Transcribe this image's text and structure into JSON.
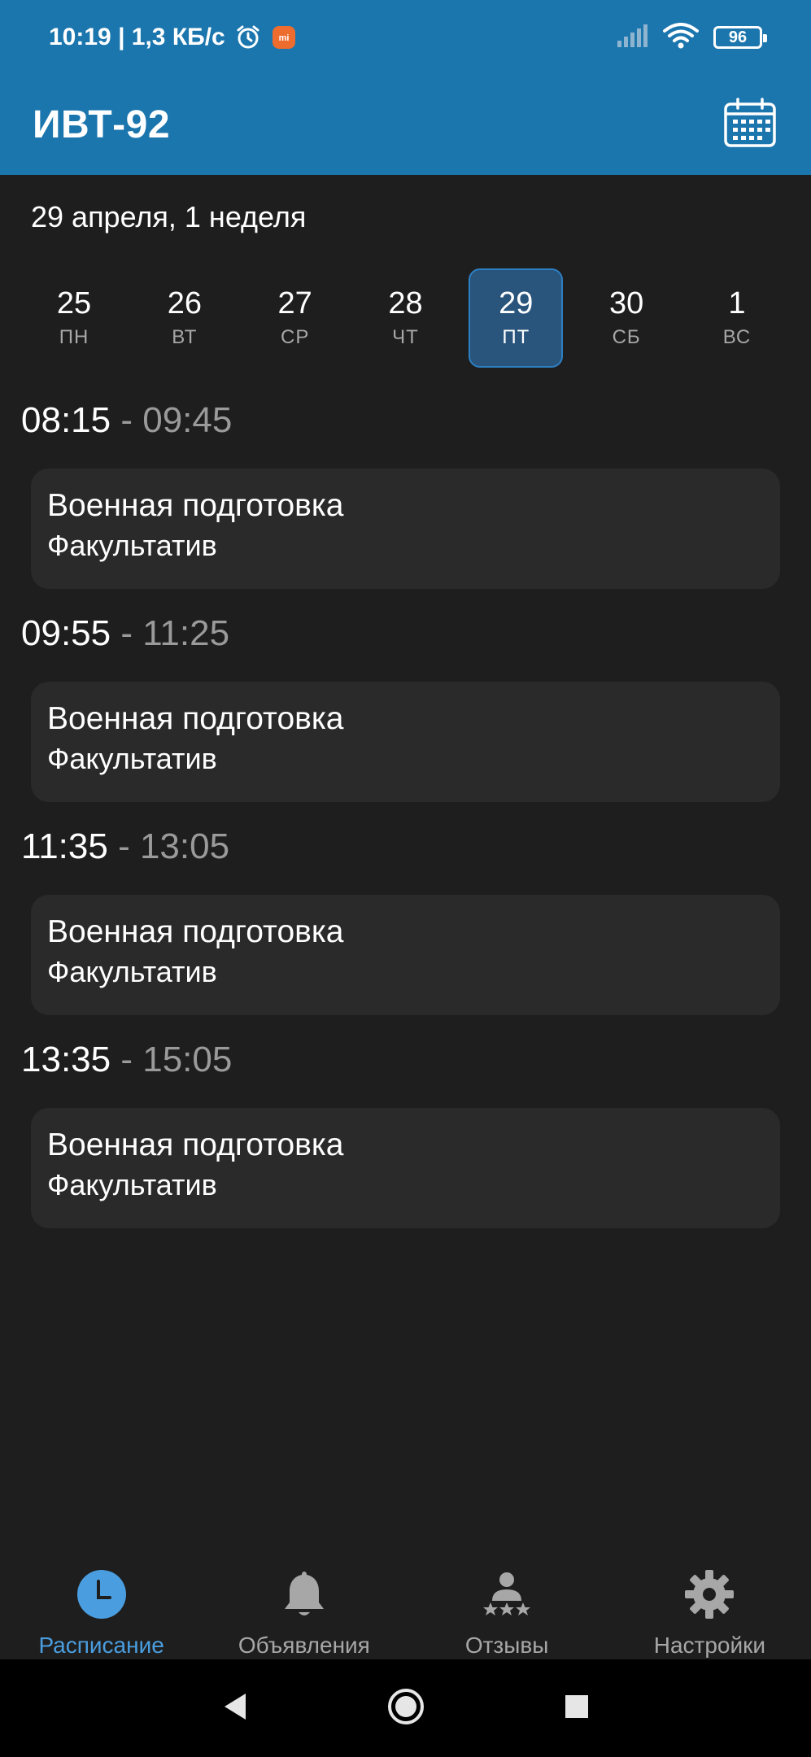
{
  "status_bar": {
    "time_speed": "10:19 | 1,3 КБ/с",
    "battery": "96"
  },
  "app_bar": {
    "title": "ИВТ-92",
    "action_icon": "calendar-icon"
  },
  "date_header": "29 апреля, 1 неделя",
  "week": [
    {
      "num": "25",
      "name": "ПН"
    },
    {
      "num": "26",
      "name": "ВТ"
    },
    {
      "num": "27",
      "name": "СР"
    },
    {
      "num": "28",
      "name": "ЧТ"
    },
    {
      "num": "29",
      "name": "ПТ",
      "selected": true
    },
    {
      "num": "30",
      "name": "СБ"
    },
    {
      "num": "1",
      "name": "ВС"
    }
  ],
  "lessons": [
    {
      "start": "08:15",
      "sep": " - ",
      "end": "09:45",
      "title": "Военная подготовка",
      "type": "Факультатив"
    },
    {
      "start": "09:55",
      "sep": " - ",
      "end": "11:25",
      "title": "Военная подготовка",
      "type": "Факультатив"
    },
    {
      "start": "11:35",
      "sep": " - ",
      "end": "13:05",
      "title": "Военная подготовка",
      "type": "Факультатив"
    },
    {
      "start": "13:35",
      "sep": " - ",
      "end": "15:05",
      "title": "Военная подготовка",
      "type": "Факультатив"
    }
  ],
  "bottom_nav": [
    {
      "label": "Расписание",
      "icon": "clock-icon",
      "active": true
    },
    {
      "label": "Объявления",
      "icon": "bell-icon"
    },
    {
      "label": "Отзывы",
      "icon": "reviews-icon"
    },
    {
      "label": "Настройки",
      "icon": "gear-icon"
    }
  ],
  "colors": {
    "primary": "#1b76ae",
    "background": "#1e1e1e",
    "card": "#2a2a2a",
    "accent": "#4a9ee0",
    "selected_day": "#29547c"
  }
}
